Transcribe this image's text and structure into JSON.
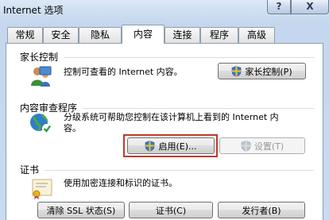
{
  "window": {
    "title": "Internet 选项",
    "help_label": "?",
    "close_label": "X"
  },
  "tabs": [
    {
      "label": "常规"
    },
    {
      "label": "安全"
    },
    {
      "label": "隐私"
    },
    {
      "label": "内容",
      "active": true
    },
    {
      "label": "连接"
    },
    {
      "label": "程序"
    },
    {
      "label": "高级"
    }
  ],
  "parental": {
    "group_label": "家长控制",
    "description": "控制可查看的 Internet 内容。",
    "button_label": "家长控制(P)"
  },
  "advisor": {
    "group_label": "内容审查程序",
    "description_line1": "分级系统可帮助您控制在该计算机上看到的 Internet 内",
    "description_line2": "容。",
    "enable_label": "启用(E)...",
    "settings_label": "设置(T)"
  },
  "certificates": {
    "group_label": "证书",
    "description": "使用加密连接和标识的证书。",
    "clear_ssl_label": "清除 SSL 状态(S)",
    "certificates_label": "证书(C)",
    "publishers_label": "发行者(B)"
  },
  "colors": {
    "highlight": "#c0392b",
    "accent": "#2b6cb0"
  }
}
